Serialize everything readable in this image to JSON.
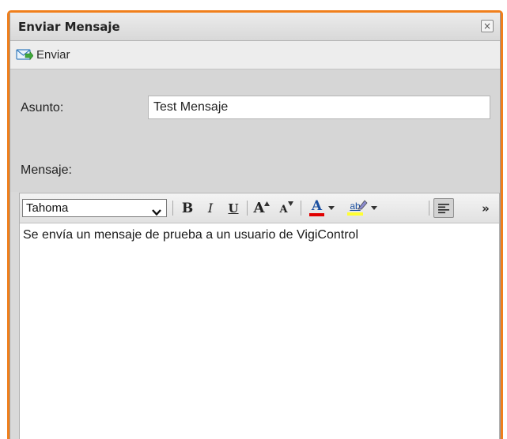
{
  "window": {
    "title": "Enviar Mensaje",
    "close_symbol": "×"
  },
  "toolbar": {
    "send_label": "Enviar",
    "send_icon": "envelope-send-icon"
  },
  "form": {
    "subject_label": "Asunto:",
    "subject_value": "Test Mensaje",
    "message_label": "Mensaje:"
  },
  "editor": {
    "font_family_value": "Tahoma",
    "bold_glyph": "B",
    "italic_glyph": "I",
    "underline_glyph": "U",
    "grow_glyph": "A",
    "shrink_glyph": "A",
    "font_color_glyph": "A",
    "highlight_glyph": "ab",
    "more_glyph": "»",
    "content": "Se envía un mensaje de prueba a un usuario de VigiControl"
  },
  "colors": {
    "window_border": "#f07f1c",
    "font_color_swatch": "#e00000",
    "highlight_swatch": "#ffff33"
  }
}
